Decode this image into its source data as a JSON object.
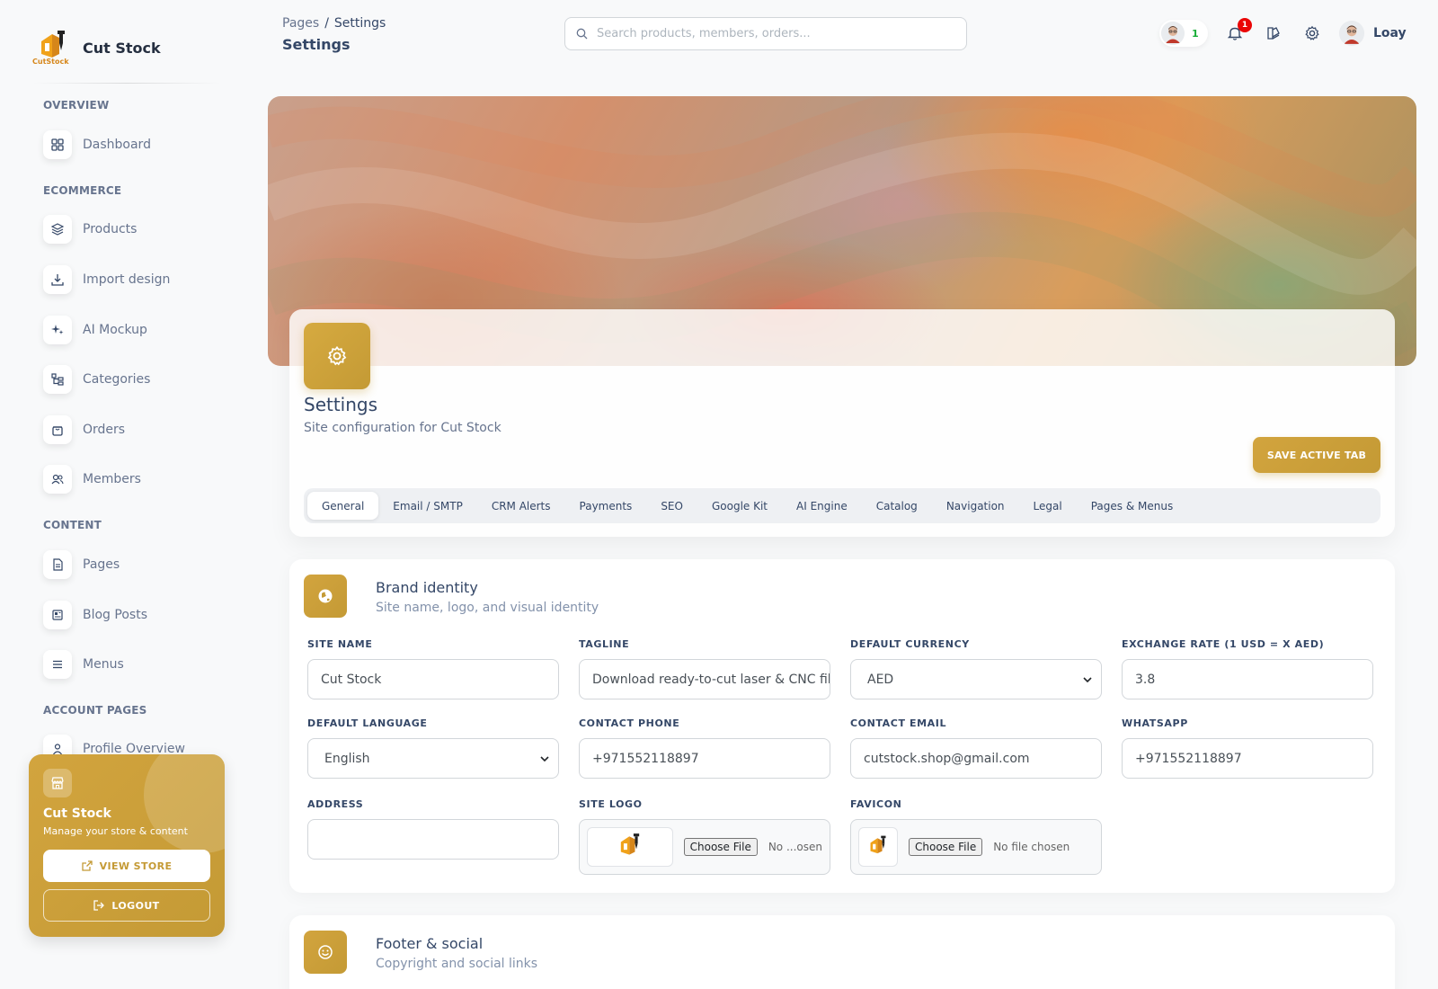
{
  "sidebar": {
    "brand_name": "Cut Stock",
    "logo_text": "CutStock",
    "sections": {
      "overview": "OVERVIEW",
      "ecommerce": "ECOMMERCE",
      "content": "CONTENT",
      "account": "ACCOUNT PAGES"
    },
    "items": {
      "dashboard": "Dashboard",
      "products": "Products",
      "import_design": "Import design",
      "ai_mockup": "AI Mockup",
      "categories": "Categories",
      "orders": "Orders",
      "members": "Members",
      "pages": "Pages",
      "blog_posts": "Blog Posts",
      "menus": "Menus",
      "profile_overview": "Profile Overview"
    },
    "store_card": {
      "title": "Cut Stock",
      "subtitle": "Manage your store & content",
      "view_store": "VIEW STORE",
      "logout": "LOGOUT"
    }
  },
  "topbar": {
    "breadcrumb_parent": "Pages",
    "breadcrumb_sep": "/",
    "breadcrumb_current": "Settings",
    "page_title": "Settings",
    "search_placeholder": "Search products, members, orders...",
    "online_count": "1",
    "notification_count": "1",
    "user_name": "Loay"
  },
  "header": {
    "title": "Settings",
    "subtitle": "Site configuration for Cut Stock",
    "save_label": "SAVE ACTIVE TAB",
    "tabs": [
      "General",
      "Email / SMTP",
      "CRM Alerts",
      "Payments",
      "SEO",
      "Google Kit",
      "AI Engine",
      "Catalog",
      "Navigation",
      "Legal",
      "Pages & Menus"
    ],
    "active_tab": "General"
  },
  "brand_identity": {
    "title": "Brand identity",
    "subtitle": "Site name, logo, and visual identity",
    "fields": {
      "site_name": {
        "label": "SITE NAME",
        "value": "Cut Stock"
      },
      "tagline": {
        "label": "TAGLINE",
        "value": "Download ready-to-cut laser & CNC file"
      },
      "default_currency": {
        "label": "DEFAULT CURRENCY",
        "value": "AED"
      },
      "exchange_rate": {
        "label": "EXCHANGE RATE (1 USD = X AED)",
        "value": "3.8"
      },
      "default_language": {
        "label": "DEFAULT LANGUAGE",
        "value": "English"
      },
      "contact_phone": {
        "label": "CONTACT PHONE",
        "value": "+971552118897"
      },
      "contact_email": {
        "label": "CONTACT EMAIL",
        "value": "cutstock.shop@gmail.com"
      },
      "whatsapp": {
        "label": "WHATSAPP",
        "value": "+971552118897"
      },
      "address": {
        "label": "ADDRESS",
        "value": ""
      },
      "site_logo": {
        "label": "SITE LOGO",
        "button": "Choose File",
        "status": "No ...osen"
      },
      "favicon": {
        "label": "FAVICON",
        "button": "Choose File",
        "status": "No file chosen"
      }
    }
  },
  "footer_social": {
    "title": "Footer & social",
    "subtitle": "Copyright and social links"
  },
  "colors": {
    "accent": "#c49a35",
    "text": "#344767",
    "muted": "#67748e",
    "badge": "#ea0606"
  }
}
